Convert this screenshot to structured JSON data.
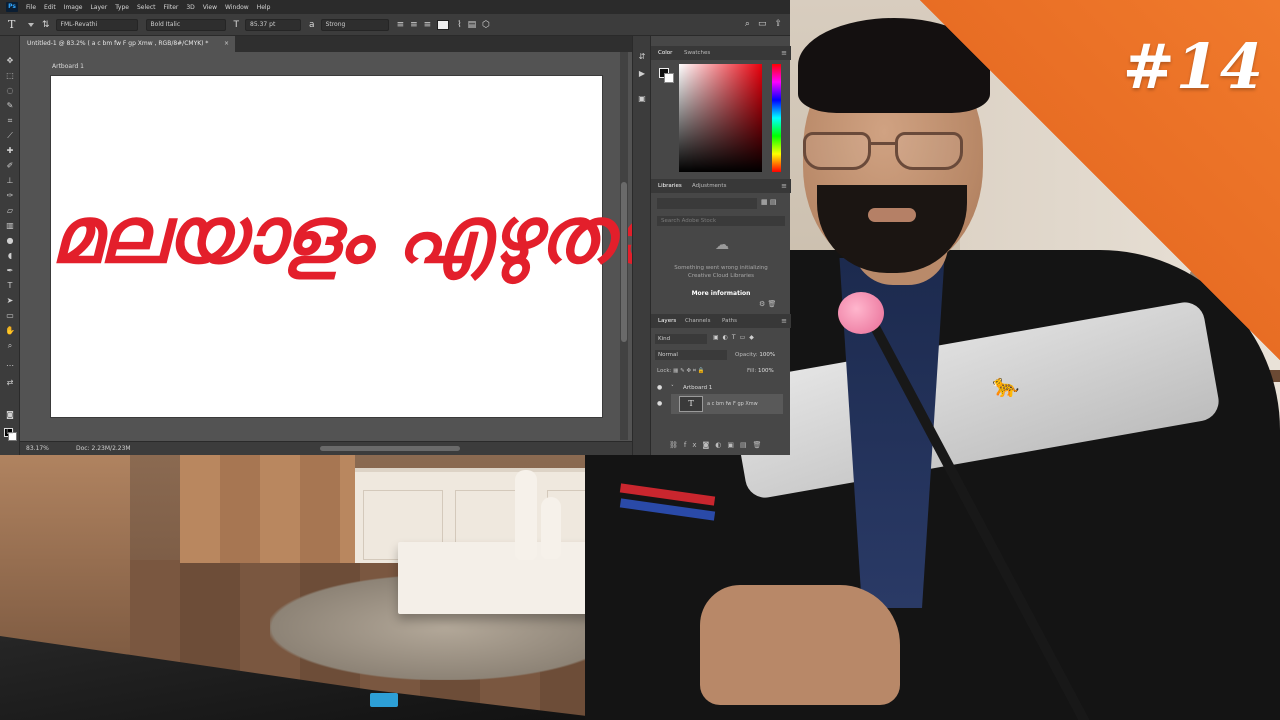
{
  "episode_badge": "#14",
  "photoshop": {
    "logo": "Ps",
    "menu": [
      "File",
      "Edit",
      "Image",
      "Layer",
      "Type",
      "Select",
      "Filter",
      "3D",
      "View",
      "Window",
      "Help"
    ],
    "options": {
      "font_family": "FML-Revathi",
      "font_style": "Bold Italic",
      "font_size": "85.37 pt",
      "anti_alias": "Strong",
      "color_hex": "#ededed"
    },
    "document_tab": {
      "title": "Untitled-1 @ 83.2% ( a c bm fw  F gp Xmw  , RGB/8#/CMYK) *",
      "close": "×"
    },
    "artboard_label": "Artboard 1",
    "canvas_text": "മലയാളം എഴുതാം",
    "canvas_text_color": "#e31f2b",
    "status": {
      "zoom": "83.17%",
      "doc_info": "Doc: 2.23M/2.23M"
    },
    "color_panel": {
      "tabs": [
        "Color",
        "Swatches"
      ],
      "active_tab": "Color",
      "hue_color": "#e8000c"
    },
    "libraries_panel": {
      "tabs": [
        "Libraries",
        "Adjustments"
      ],
      "search_placeholder": "Search Adobe Stock",
      "message": "Something went wrong initializing Creative Cloud Libraries",
      "more_info": "More information"
    },
    "layers_panel": {
      "tabs": [
        "Layers",
        "Channels",
        "Paths"
      ],
      "filter": "Kind",
      "blend_mode": "Normal",
      "opacity_label": "Opacity:",
      "opacity_value": "100%",
      "lock_label": "Lock:",
      "fill_label": "Fill:",
      "fill_value": "100%",
      "layers": [
        {
          "name": "Artboard 1",
          "type": "group"
        },
        {
          "name": "a c bm fw  F gp Xmw",
          "type": "text"
        }
      ]
    }
  },
  "icons": {
    "type_tool": "T",
    "dropdown": "▾",
    "search": "⌕",
    "workspace": "▭",
    "eye": "●",
    "cloud_error": "☁",
    "panel_menu": "≡"
  },
  "colors": {
    "badge_orange": "#f07a2c",
    "ps_dark": "#2b2b2b",
    "ps_panel": "#474747"
  }
}
